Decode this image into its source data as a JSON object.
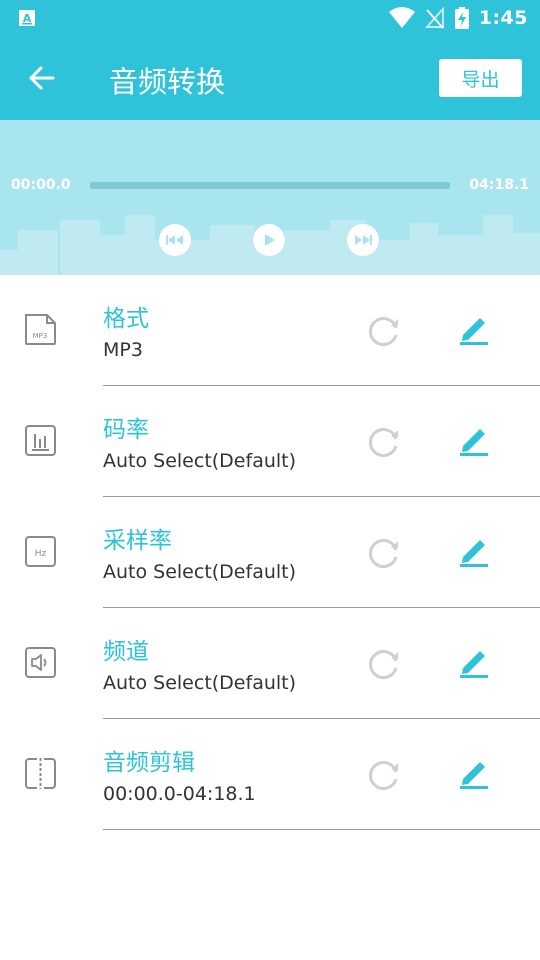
{
  "status_bar": {
    "time": "1:45"
  },
  "app_bar": {
    "title": "音频转换",
    "export_label": "导出"
  },
  "player": {
    "current_time": "00:00.0",
    "total_time": "04:18.1",
    "progress": 0
  },
  "settings": [
    {
      "label": "格式",
      "value": "MP3",
      "icon": "mp3-file-icon"
    },
    {
      "label": "码率",
      "value": "Auto Select(Default)",
      "icon": "bitrate-icon"
    },
    {
      "label": "采样率",
      "value": "Auto Select(Default)",
      "icon": "hz-icon"
    },
    {
      "label": "频道",
      "value": "Auto Select(Default)",
      "icon": "speaker-icon"
    },
    {
      "label": "音频剪辑",
      "value": "00:00.0-04:18.1",
      "icon": "cut-icon"
    }
  ],
  "colors": {
    "accent": "#2ec3d8",
    "player_bg": "#a9e5ef",
    "icon_gray": "#8a8a8a",
    "text": "#333333"
  }
}
